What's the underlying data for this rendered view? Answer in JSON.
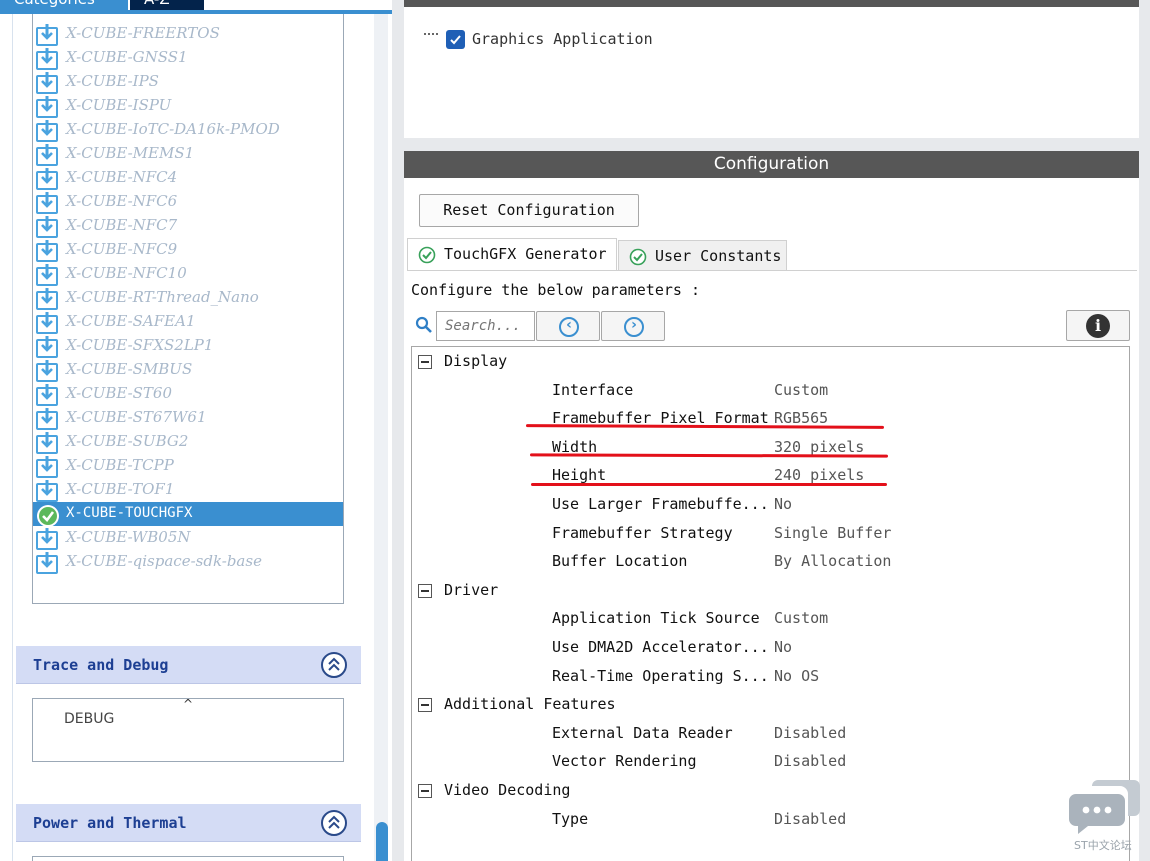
{
  "left_panel": {
    "tabs": [
      "Categories",
      "A-Z"
    ],
    "packs": [
      {
        "label": "X-CUBE-FREERTOS",
        "selected": false
      },
      {
        "label": "X-CUBE-GNSS1",
        "selected": false
      },
      {
        "label": "X-CUBE-IPS",
        "selected": false
      },
      {
        "label": "X-CUBE-ISPU",
        "selected": false
      },
      {
        "label": "X-CUBE-IoTC-DA16k-PMOD",
        "selected": false
      },
      {
        "label": "X-CUBE-MEMS1",
        "selected": false
      },
      {
        "label": "X-CUBE-NFC4",
        "selected": false
      },
      {
        "label": "X-CUBE-NFC6",
        "selected": false
      },
      {
        "label": "X-CUBE-NFC7",
        "selected": false
      },
      {
        "label": "X-CUBE-NFC9",
        "selected": false
      },
      {
        "label": "X-CUBE-NFC10",
        "selected": false
      },
      {
        "label": "X-CUBE-RT-Thread_Nano",
        "selected": false
      },
      {
        "label": "X-CUBE-SAFEA1",
        "selected": false
      },
      {
        "label": "X-CUBE-SFXS2LP1",
        "selected": false
      },
      {
        "label": "X-CUBE-SMBUS",
        "selected": false
      },
      {
        "label": "X-CUBE-ST60",
        "selected": false
      },
      {
        "label": "X-CUBE-ST67W61",
        "selected": false
      },
      {
        "label": "X-CUBE-SUBG2",
        "selected": false
      },
      {
        "label": "X-CUBE-TCPP",
        "selected": false
      },
      {
        "label": "X-CUBE-TOF1",
        "selected": false
      },
      {
        "label": "X-CUBE-TOUCHGFX",
        "selected": true
      },
      {
        "label": "X-CUBE-WB05N",
        "selected": false
      },
      {
        "label": "X-CUBE-qispace-sdk-base",
        "selected": false
      }
    ],
    "trace_debug": {
      "title": "Trace and Debug",
      "items": [
        "DEBUG"
      ]
    },
    "power_thermal": {
      "title": "Power and Thermal"
    }
  },
  "mode": {
    "items": [
      {
        "label": "Graphics Application",
        "checked": true
      }
    ]
  },
  "configuration": {
    "title": "Configuration",
    "reset_label": "Reset Configuration",
    "tabs": [
      {
        "label": "TouchGFX Generator",
        "active": true
      },
      {
        "label": "User Constants",
        "active": false
      }
    ],
    "prompt": "Configure the below parameters :",
    "search_placeholder": "Search...",
    "groups": [
      {
        "label": "Display",
        "params": [
          {
            "name": "Interface",
            "value": "Custom"
          },
          {
            "name": "Framebuffer Pixel Format",
            "value": "RGB565"
          },
          {
            "name": "Width",
            "value": "320 pixels"
          },
          {
            "name": "Height",
            "value": "240 pixels"
          },
          {
            "name": "Use Larger Framebuffe...",
            "value": "No"
          },
          {
            "name": "Framebuffer Strategy",
            "value": "Single Buffer"
          },
          {
            "name": "Buffer Location",
            "value": "By Allocation"
          }
        ]
      },
      {
        "label": "Driver",
        "params": [
          {
            "name": "Application Tick Source",
            "value": "Custom"
          },
          {
            "name": "Use DMA2D Accelerator...",
            "value": "No"
          },
          {
            "name": "Real-Time Operating S...",
            "value": "No OS"
          }
        ]
      },
      {
        "label": "Additional Features",
        "params": [
          {
            "name": "External Data Reader",
            "value": "Disabled"
          },
          {
            "name": "Vector Rendering",
            "value": "Disabled"
          }
        ]
      },
      {
        "label": "Video Decoding",
        "params": [
          {
            "name": "Type",
            "value": "Disabled"
          }
        ]
      }
    ]
  },
  "watermark": "ST中文论坛",
  "colors": {
    "accent": "#3a8fd0",
    "header_bar": "#575757",
    "annotation": "#e3101a",
    "section_header": "#d4dcf5"
  }
}
